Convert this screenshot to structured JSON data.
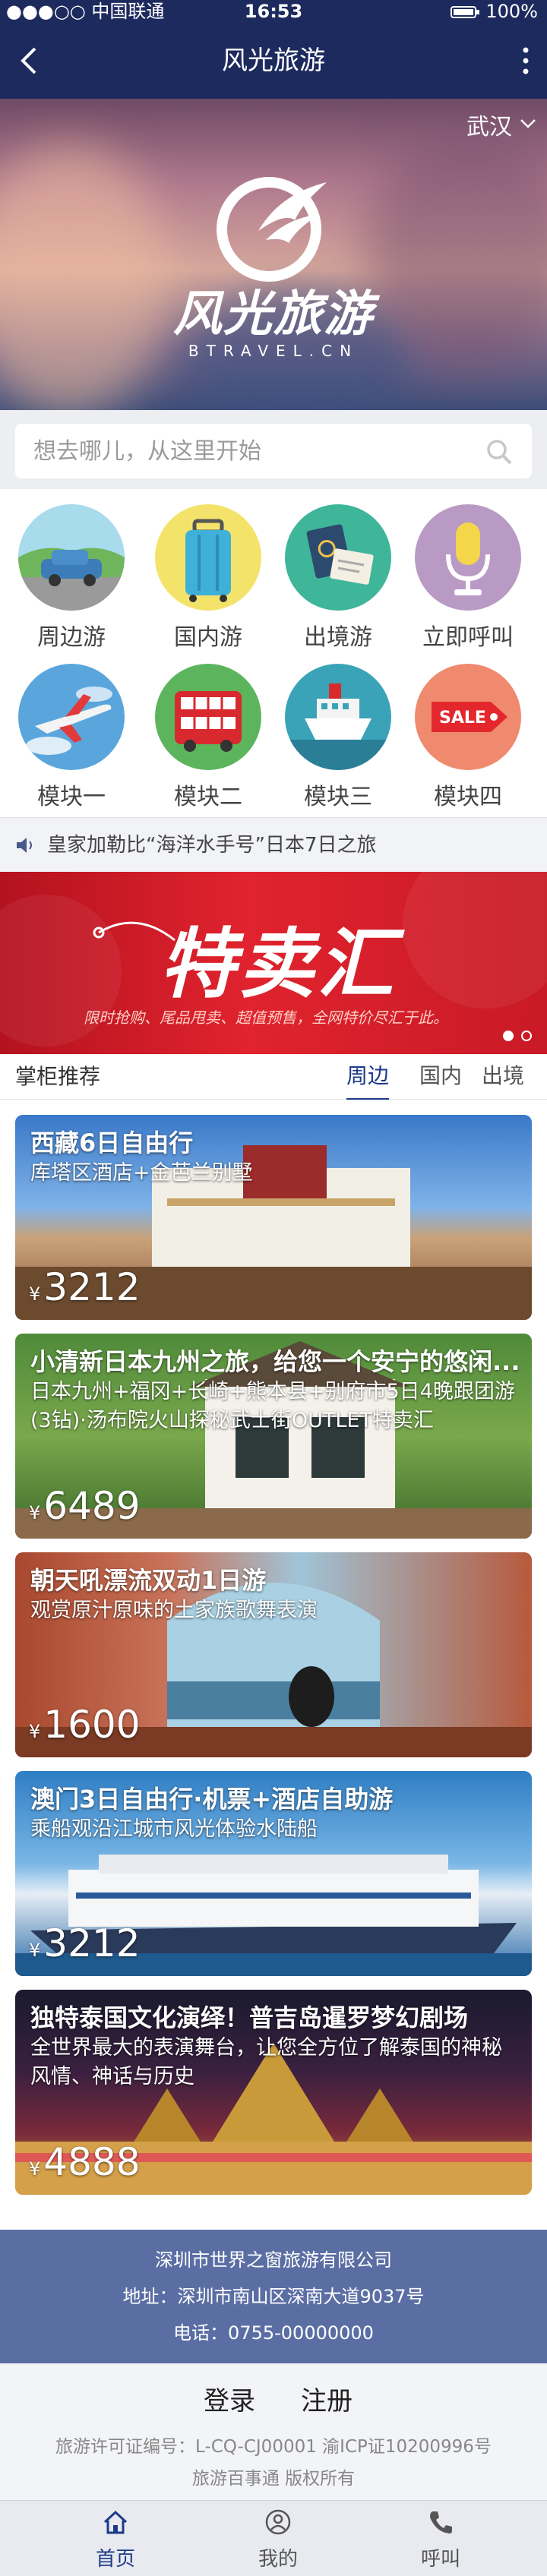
{
  "status_bar": {
    "carrier": "●●●○○ 中国联通",
    "time": "16:53",
    "battery": "100%"
  },
  "nav": {
    "title": "风光旅游"
  },
  "hero": {
    "city": "武汉",
    "logo_text": "风光旅游",
    "logo_sub": "BTRAVEL.CN"
  },
  "search": {
    "placeholder": "想去哪儿，从这里开始"
  },
  "modules": [
    {
      "label": "周边游",
      "icon": "car-icon"
    },
    {
      "label": "国内游",
      "icon": "suitcase-icon"
    },
    {
      "label": "出境游",
      "icon": "passport-icon"
    },
    {
      "label": "立即呼叫",
      "icon": "microphone-icon"
    },
    {
      "label": "模块一",
      "icon": "airplane-icon"
    },
    {
      "label": "模块二",
      "icon": "bus-icon"
    },
    {
      "label": "模块三",
      "icon": "ship-icon"
    },
    {
      "label": "模块四",
      "icon": "sale-tag-icon"
    }
  ],
  "notice": {
    "text": "皇家加勒比“海洋水手号”日本7日之旅"
  },
  "banner": {
    "headline": "特卖汇",
    "slogan": "限时抢购、尾品甩卖、超值预售，全网特价尽汇于此。"
  },
  "recommend": {
    "title": "掌柜推荐",
    "tabs": [
      "周边",
      "国内",
      "出境"
    ]
  },
  "cards": [
    {
      "title": "西藏6日自由行",
      "sub": "库塔区酒店+金芭兰别墅",
      "currency": "¥",
      "price": "3212"
    },
    {
      "title": "小清新日本九州之旅，给您一个安宁的悠闲...",
      "sub": "日本九州+福冈+长崎+熊本县+别府市5日4晚跟团游(3钻)·汤布院火山探秘武士街OUTLET特卖汇",
      "currency": "¥",
      "price": "6489"
    },
    {
      "title": "朝天吼漂流双动1日游",
      "sub": "观赏原汁原味的土家族歌舞表演",
      "currency": "¥",
      "price": "1600"
    },
    {
      "title": "澳门3日自由行·机票+酒店自助游",
      "sub": "乘船观沿江城市风光体验水陆船",
      "currency": "¥",
      "price": "3212"
    },
    {
      "title": "独特泰国文化演绎！普吉岛暹罗梦幻剧场",
      "sub": "全世界最大的表演舞台，让您全方位了解泰国的神秘风情、神话与历史",
      "currency": "¥",
      "price": "4888"
    }
  ],
  "footer": {
    "company": "深圳市世界之窗旅游有限公司",
    "address": "地址：深圳市南山区深南大道9037号",
    "phone": "电话：0755-00000000"
  },
  "links": {
    "login": "登录",
    "register": "注册",
    "license": "旅游许可证编号：L-CQ-CJ00001 渝ICP证10200996号",
    "copyright": "旅游百事通 版权所有"
  },
  "tabbar": [
    {
      "label": "首页",
      "icon": "home-icon",
      "active": true
    },
    {
      "label": "我的",
      "icon": "user-icon",
      "active": false
    },
    {
      "label": "呼叫",
      "icon": "phone-icon",
      "active": false
    }
  ],
  "colors": {
    "nav": "#1d2a5e",
    "accent": "#1d3a8a",
    "footer": "#5b6ea4",
    "banner": "#e0232e"
  }
}
